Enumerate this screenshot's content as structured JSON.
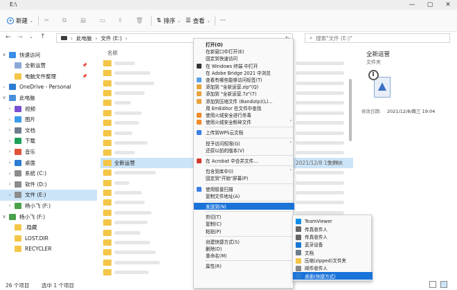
{
  "window": {
    "title": "E:\\",
    "controls": [
      "—",
      "▢",
      "✕"
    ]
  },
  "toolbar": {
    "new_label": "新建",
    "sort_label": "排序",
    "view_label": "查看",
    "more_label": "···"
  },
  "address": {
    "breadcrumb": [
      "此电脑",
      "文件 (E:)"
    ],
    "search_placeholder": "搜索\"文件 (E:)\""
  },
  "nav": {
    "items": [
      {
        "label": "快速访问",
        "chev": "∨",
        "icon_color": "#3b8ee8",
        "level": 0
      },
      {
        "label": "全新运营",
        "chev": "",
        "icon_color": "#8aa9d6",
        "level": 1,
        "pin": "📌"
      },
      {
        "label": "电脑文件整理",
        "chev": "",
        "icon_color": "#f4c647",
        "level": 1,
        "pin": "📌"
      },
      {
        "label": "OneDrive - Personal",
        "chev": "›",
        "icon_color": "#2b7cd3",
        "level": 0
      },
      {
        "label": "此电脑",
        "chev": "∨",
        "icon_color": "#4a90d9",
        "level": 0
      },
      {
        "label": "视频",
        "chev": "›",
        "icon_color": "#7a4fd1",
        "level": 1
      },
      {
        "label": "图片",
        "chev": "›",
        "icon_color": "#3b9be8",
        "level": 1
      },
      {
        "label": "文档",
        "chev": "›",
        "icon_color": "#6f7c8c",
        "level": 1
      },
      {
        "label": "下载",
        "chev": "›",
        "icon_color": "#1f9f5a",
        "level": 1
      },
      {
        "label": "音乐",
        "chev": "›",
        "icon_color": "#e0533b",
        "level": 1
      },
      {
        "label": "桌面",
        "chev": "›",
        "icon_color": "#2a7dd1",
        "level": 1
      },
      {
        "label": "系统 (C:)",
        "chev": "›",
        "icon_color": "#8c8c8c",
        "level": 1
      },
      {
        "label": "软件 (D:)",
        "chev": "›",
        "icon_color": "#8c8c8c",
        "level": 1
      },
      {
        "label": "文件 (E:)",
        "chev": "›",
        "icon_color": "#8c8c8c",
        "level": 1,
        "selected": true
      },
      {
        "label": "杨小飞 (F:)",
        "chev": "›",
        "icon_color": "#4aa14a",
        "level": 1
      },
      {
        "label": "杨小飞 (F:)",
        "chev": "∨",
        "icon_color": "#4aa14a",
        "level": 0
      },
      {
        "label": ".隐藏",
        "chev": "",
        "icon_color": "#f4c647",
        "level": 1
      },
      {
        "label": "LOST.DIR",
        "chev": "",
        "icon_color": "#f4c647",
        "level": 1
      },
      {
        "label": "RECYCLER",
        "chev": "",
        "icon_color": "#f4c647",
        "level": 1
      }
    ]
  },
  "files": {
    "column_name": "名称",
    "selected_name": "全新运营",
    "selected_date": "2021/12/8 19:04",
    "selected_type": "文件夹"
  },
  "preview": {
    "title": "全新运营",
    "type": "文件夹",
    "modified_label": "修改日期:",
    "modified_value": "2021/12/8/周三 19:04"
  },
  "status": {
    "count": "26 个项目",
    "selected": "选中 1 个项目"
  },
  "context_menu": {
    "items": [
      {
        "label": "打开(O)",
        "bold": true
      },
      {
        "label": "在新窗口中打开(E)"
      },
      {
        "label": "固定到快速访问"
      },
      {
        "label": "在 Windows 终端 中打开",
        "icon_color": "#333"
      },
      {
        "label": "在 Adobe Bridge 2021 中浏览"
      },
      {
        "label": "查看有哪些能够访问标签(T)",
        "icon_color": "#5aa0e6"
      },
      {
        "label": "添加到 \"全新运营.zip\"(Q)",
        "icon_color": "#e8a33c"
      },
      {
        "label": "添加到 \"全新运营.7z\"(7)",
        "icon_color": "#e8a33c"
      },
      {
        "label": "添加到压缩文件 (Bandizip)(L)...",
        "icon_color": "#e8a33c"
      },
      {
        "label": "用 EmEditor 在文件中查找"
      },
      {
        "label": "使用火绒安全进行杀毒",
        "icon_color": "#f08a2a"
      },
      {
        "label": "使用火绒安全粉碎文件",
        "icon_color": "#f08a2a",
        "arrow": true
      },
      {
        "sep": true
      },
      {
        "label": "上传到WPS云文档",
        "icon_color": "#3c7ee8"
      },
      {
        "sep": true
      },
      {
        "label": "授予访问权限(G)",
        "arrow": true
      },
      {
        "label": "还原以前的版本(V)"
      },
      {
        "sep": true
      },
      {
        "label": "在 Acrobat 中合并文件...",
        "icon_color": "#d33a2c"
      },
      {
        "sep": true
      },
      {
        "label": "包含到库中(I)",
        "arrow": true
      },
      {
        "label": "固定到\"开始\"屏幕(P)"
      },
      {
        "sep": true
      },
      {
        "label": "使用智量扫描",
        "icon_color": "#3c7ee8"
      },
      {
        "label": "复制文件地址(A)"
      },
      {
        "sep": true
      },
      {
        "label": "发送到(N)",
        "arrow": true,
        "highlight": true
      },
      {
        "sep": true
      },
      {
        "label": "剪切(T)"
      },
      {
        "label": "复制(C)"
      },
      {
        "label": "粘贴(P)"
      },
      {
        "sep": true
      },
      {
        "label": "创建快捷方式(S)"
      },
      {
        "label": "删除(D)"
      },
      {
        "label": "重命名(M)"
      },
      {
        "sep": true
      },
      {
        "label": "属性(R)"
      }
    ]
  },
  "send_to_menu": {
    "items": [
      {
        "label": "TeamViewer",
        "icon_color": "#0e8ee9"
      },
      {
        "label": "传真收件人",
        "icon_color": "#666"
      },
      {
        "label": "传真收件人",
        "icon_color": "#666"
      },
      {
        "label": "蓝牙设备",
        "icon_color": "#1976d2"
      },
      {
        "label": "文档",
        "icon_color": "#6f7c8c"
      },
      {
        "label": "压缩(zipped)文件夹",
        "icon_color": "#f4c647"
      },
      {
        "label": "邮件收件人",
        "icon_color": "#888"
      },
      {
        "label": "桌面(快捷方式)",
        "icon_color": "#2a7dd1",
        "highlight": true
      }
    ]
  }
}
